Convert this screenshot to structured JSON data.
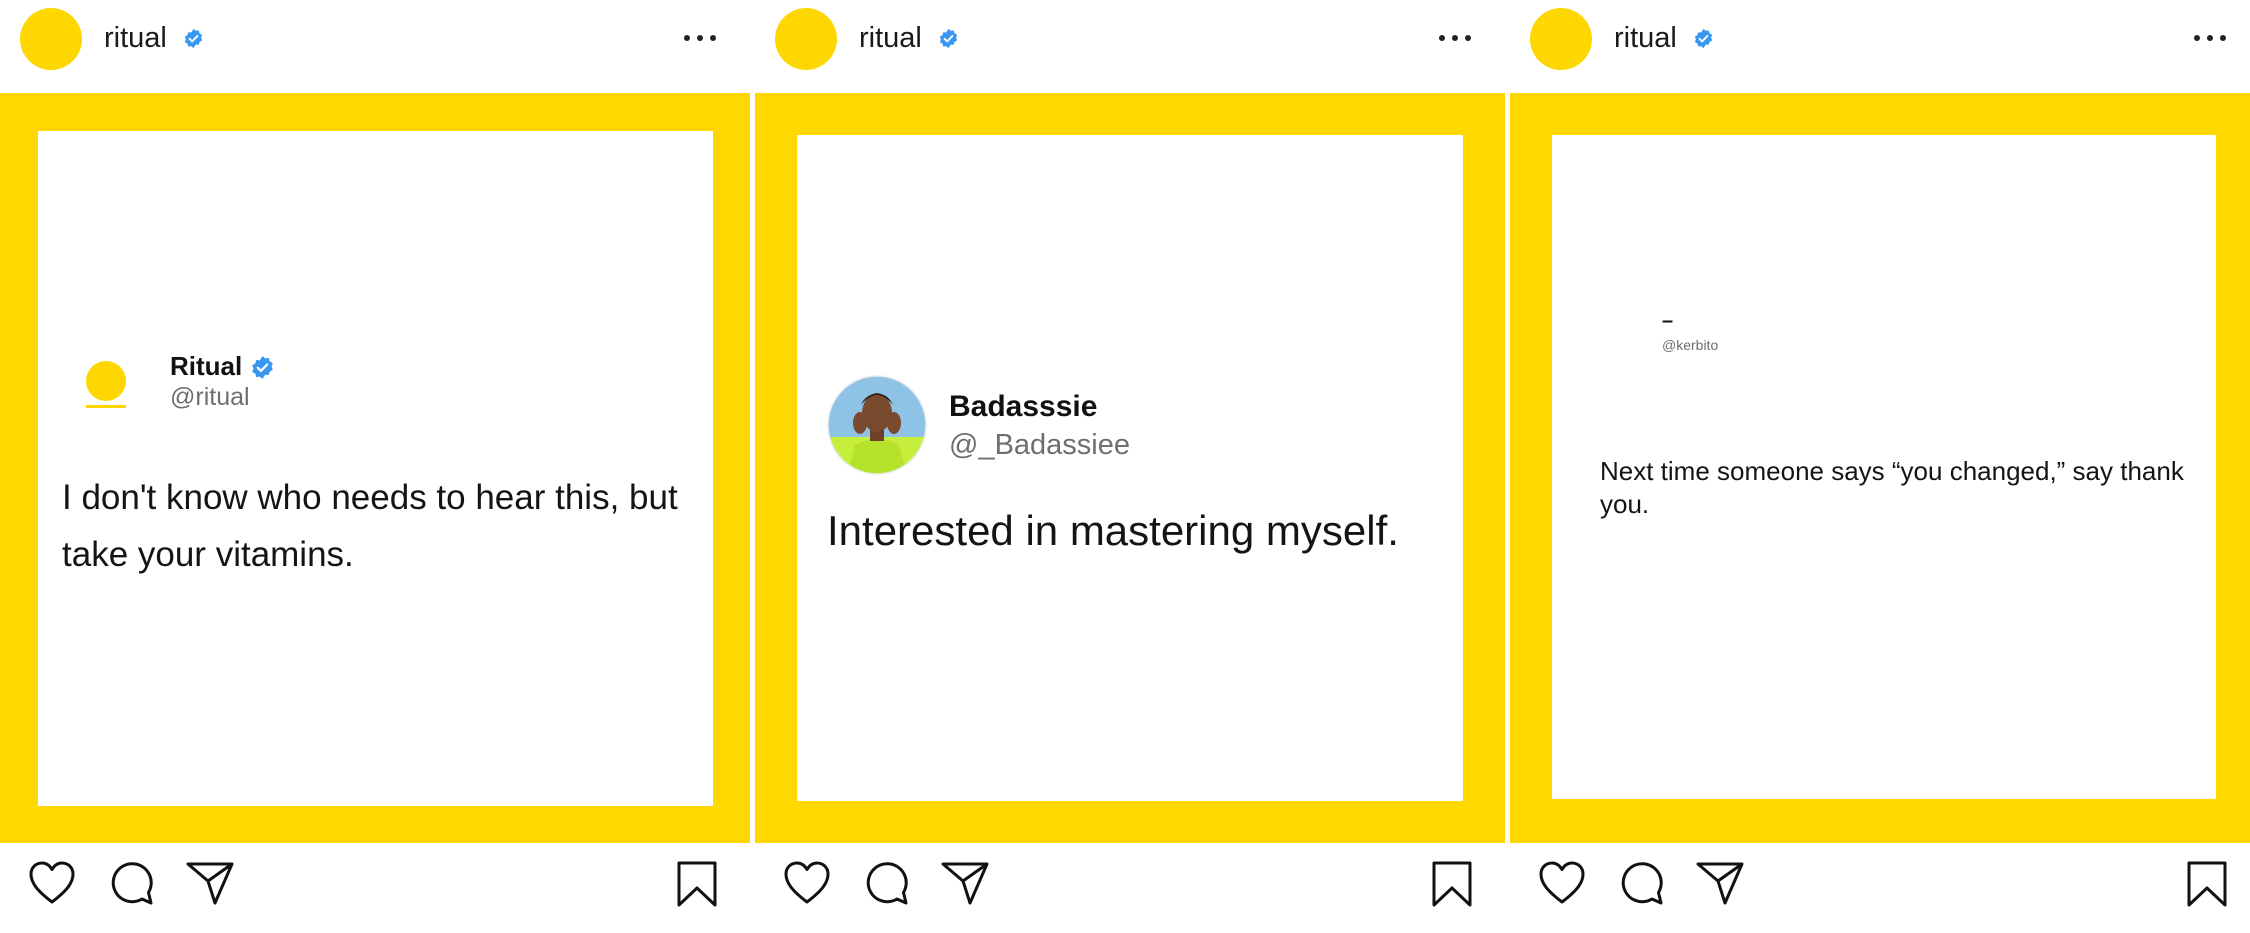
{
  "posts": [
    {
      "account": {
        "username": "ritual",
        "verified": true,
        "avatar_color": "#FFD700"
      },
      "frame_color": "#FFD800",
      "tweet": {
        "name": "Ritual",
        "handle": "@ritual",
        "verified": true,
        "text": "I don't know who needs to hear this, but take your vitamins."
      }
    },
    {
      "account": {
        "username": "ritual",
        "verified": true,
        "avatar_color": "#FFD700"
      },
      "frame_color": "#FFD800",
      "tweet": {
        "name": "Badasssie",
        "handle": "@_Badassiee",
        "verified": false,
        "avatar": "user-photo",
        "text": "Interested in mastering myself."
      }
    },
    {
      "account": {
        "username": "ritual",
        "verified": true,
        "avatar_color": "#FFD700"
      },
      "frame_color": "#FFD800",
      "tweet": {
        "name": "–",
        "handle": "@kerbito",
        "verified": false,
        "text": "Next time someone says “you changed,” say thank you."
      }
    }
  ],
  "actions": [
    "heart-icon",
    "comment-icon",
    "share-icon",
    "bookmark-icon"
  ],
  "colors": {
    "accent_yellow": "#FFD800",
    "verified_blue": "#3897F0",
    "handle_gray": "#6b6f73"
  }
}
